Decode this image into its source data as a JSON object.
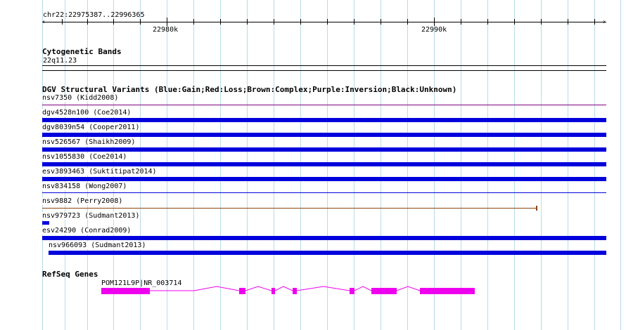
{
  "ruler": {
    "coords": "chr22:22975387..22996365",
    "major_tick_labels": [
      "22980k",
      "22990k"
    ]
  },
  "cytoband": {
    "title": "Cytogenetic Bands",
    "band": "22q11.23"
  },
  "dgv": {
    "title": "DGV Structural Variants (Blue:Gain;Red:Loss;Brown:Complex;Purple:Inversion;Black:Unknown)",
    "colors": {
      "gain": "#0000dd",
      "loss": "#cc0000",
      "complex": "#8b4513",
      "inversion": "#800080",
      "unknown": "#000000"
    },
    "variants": [
      {
        "label": "nsv7350 (Kidd2008)",
        "type": "inversion"
      },
      {
        "label": "dgv4528n100 (Coe2014)",
        "type": "gain"
      },
      {
        "label": "dgv8039n54 (Cooper2011)",
        "type": "gain"
      },
      {
        "label": "nsv526567 (Shaikh2009)",
        "type": "gain"
      },
      {
        "label": "nsv1055830 (Coe2014)",
        "type": "gain"
      },
      {
        "label": "esv3893463 (Suktitipat2014)",
        "type": "gain"
      },
      {
        "label": "nsv834158 (Wong2007)",
        "type": "gain"
      },
      {
        "label": "nsv9882 (Perry2008)",
        "type": "complex"
      },
      {
        "label": "nsv979723 (Sudmant2013)",
        "type": "gain"
      },
      {
        "label": "esv24290 (Conrad2009)",
        "type": "gain"
      },
      {
        "label": "nsv966093 (Sudmant2013)",
        "type": "gain"
      }
    ]
  },
  "refseq": {
    "title": "RefSeq Genes",
    "gene_label": "POM121L9P|NR_003714",
    "color": "#ee00ee"
  }
}
